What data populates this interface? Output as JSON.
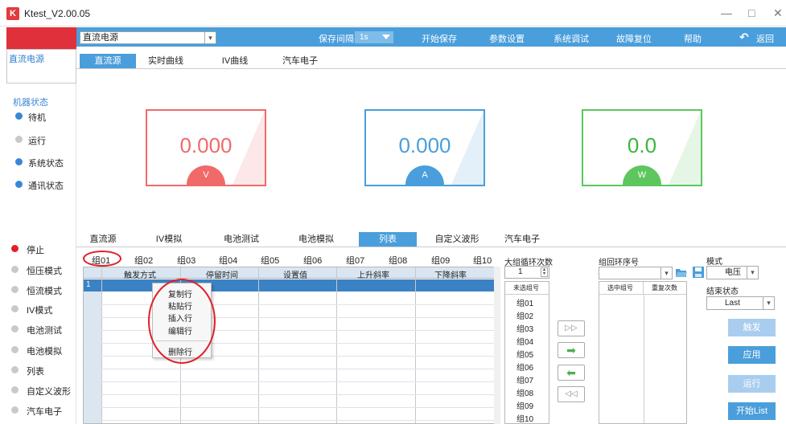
{
  "window": {
    "title": "Ktest_V2.00.05",
    "icon_letter": "K",
    "minimize": "—",
    "maximize": "□",
    "close": "✕"
  },
  "topbar": {
    "source_combo": "直流电源",
    "save_interval_label": "保存间隔",
    "save_interval_value": "1s",
    "start_save": "开始保存",
    "param_settings": "参数设置",
    "sys_debug": "系统调试",
    "fault_reset": "故障复位",
    "help": "帮助",
    "back": "返回",
    "back_icon": "↶"
  },
  "sidebar": {
    "source_name": "直流电源",
    "machine_status_title": "机器状态",
    "status": [
      {
        "label": "待机",
        "color": "#3a86d6"
      },
      {
        "label": "运行",
        "color": "#c9c9c9"
      },
      {
        "label": "系统状态",
        "color": "#3a86d6"
      },
      {
        "label": "通讯状态",
        "color": "#3a86d6"
      }
    ],
    "modes": [
      {
        "label": "停止",
        "color": "#e0202a"
      },
      {
        "label": "恒压模式",
        "color": "#c9c9c9"
      },
      {
        "label": "恒流模式",
        "color": "#c9c9c9"
      },
      {
        "label": "IV模式",
        "color": "#c9c9c9"
      },
      {
        "label": "电池测试",
        "color": "#c9c9c9"
      },
      {
        "label": "电池模拟",
        "color": "#c9c9c9"
      },
      {
        "label": "列表",
        "color": "#c9c9c9"
      },
      {
        "label": "自定义波形",
        "color": "#c9c9c9"
      },
      {
        "label": "汽车电子",
        "color": "#c9c9c9"
      }
    ]
  },
  "top_tabs": [
    "直流源",
    "实时曲线",
    "IV曲线",
    "汽车电子"
  ],
  "meters": [
    {
      "value": "0.000",
      "unit": "V",
      "color": "#f06a6a"
    },
    {
      "value": "0.000",
      "unit": "A",
      "color": "#4a9edb"
    },
    {
      "value": "0.0",
      "unit": "W",
      "color": "#5dc75d"
    }
  ],
  "bottom_tabs": [
    "直流源",
    "IV模拟",
    "电池测试",
    "电池模拟",
    "列表",
    "自定义波形",
    "汽车电子"
  ],
  "groups": [
    "组01",
    "组02",
    "组03",
    "组04",
    "组05",
    "组06",
    "组07",
    "组08",
    "组09",
    "组10"
  ],
  "grid": {
    "headers": [
      "触发方式",
      "停留时间",
      "设置值",
      "上升斜率",
      "下降斜率"
    ],
    "first_row_num": "1"
  },
  "context_menu": [
    "复制行",
    "粘贴行",
    "插入行",
    "编辑行",
    "删除行"
  ],
  "loop": {
    "big_loop_label": "大组循环次数",
    "big_loop_value": "1",
    "unselected_header": "未选组号",
    "unselected_groups": [
      "组01",
      "组02",
      "组03",
      "组04",
      "组05",
      "组06",
      "组07",
      "组08",
      "组09",
      "组10"
    ],
    "group_loop_label": "组回环序号",
    "selected_header": "选中组号",
    "repeat_header": "重复次数",
    "arrow_buttons": [
      "▷▷",
      "➡",
      "⬅",
      "◁◁"
    ]
  },
  "right_panel": {
    "mode_label": "模式",
    "mode_value": "电压",
    "end_state_label": "结束状态",
    "end_state_value": "Last",
    "buttons": [
      {
        "label": "触发",
        "enabled": false
      },
      {
        "label": "应用",
        "enabled": true
      },
      {
        "label": "运行",
        "enabled": false
      },
      {
        "label": "开始List",
        "enabled": true
      }
    ]
  }
}
